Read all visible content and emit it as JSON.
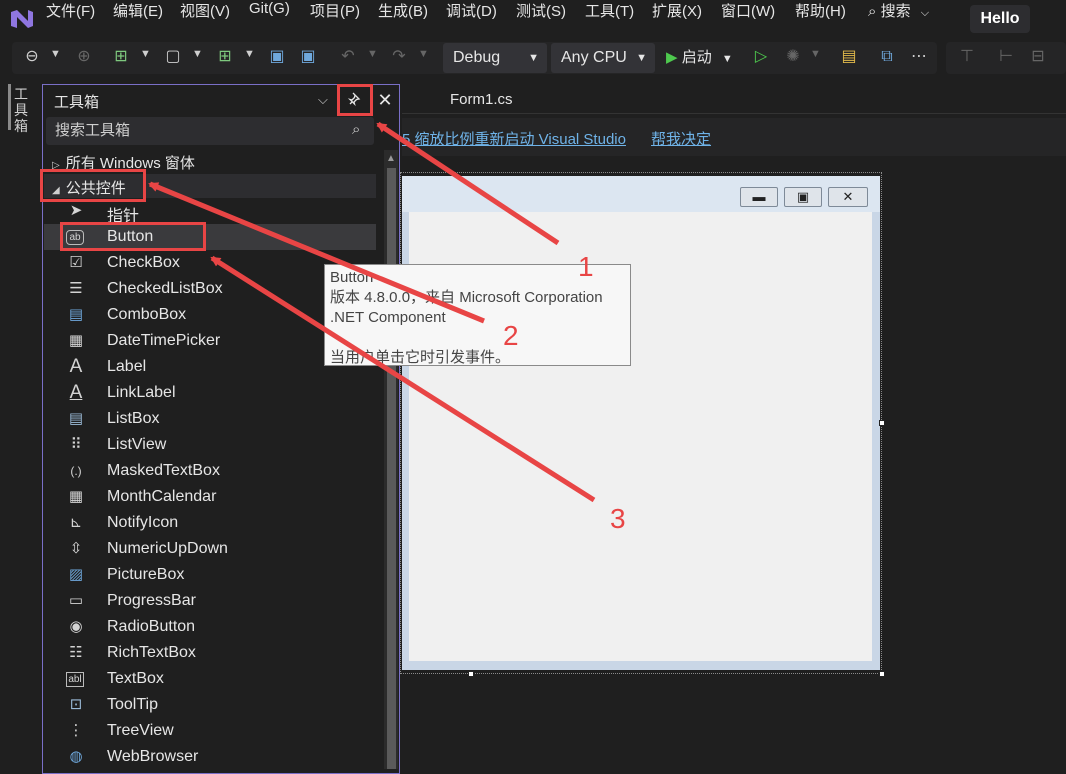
{
  "menubar": {
    "items": [
      "文件(F)",
      "编辑(E)",
      "视图(V)",
      "Git(G)",
      "项目(P)",
      "生成(B)",
      "调试(D)",
      "测试(S)",
      "工具(T)",
      "扩展(X)",
      "窗口(W)",
      "帮助(H)"
    ],
    "search_label": "搜索",
    "profile_label": "Hello"
  },
  "toolbar": {
    "config": "Debug",
    "platform": "Any CPU",
    "start_label": "启动"
  },
  "left_strip": {
    "label": "工具箱"
  },
  "toolbox": {
    "title": "工具箱",
    "search_placeholder": "搜索工具箱",
    "groups": [
      {
        "label": "所有 Windows 窗体",
        "expanded": false
      },
      {
        "label": "公共控件",
        "expanded": true
      }
    ],
    "items": [
      {
        "label": "指针",
        "icon": "pointer-icon"
      },
      {
        "label": "Button",
        "icon": "button-icon"
      },
      {
        "label": "CheckBox",
        "icon": "checkbox-icon"
      },
      {
        "label": "CheckedListBox",
        "icon": "checkedlistbox-icon"
      },
      {
        "label": "ComboBox",
        "icon": "combobox-icon"
      },
      {
        "label": "DateTimePicker",
        "icon": "datetimepicker-icon"
      },
      {
        "label": "Label",
        "icon": "label-icon"
      },
      {
        "label": "LinkLabel",
        "icon": "linklabel-icon"
      },
      {
        "label": "ListBox",
        "icon": "listbox-icon"
      },
      {
        "label": "ListView",
        "icon": "listview-icon"
      },
      {
        "label": "MaskedTextBox",
        "icon": "maskedtextbox-icon"
      },
      {
        "label": "MonthCalendar",
        "icon": "monthcalendar-icon"
      },
      {
        "label": "NotifyIcon",
        "icon": "notifyicon-icon"
      },
      {
        "label": "NumericUpDown",
        "icon": "numericupdown-icon"
      },
      {
        "label": "PictureBox",
        "icon": "picturebox-icon"
      },
      {
        "label": "ProgressBar",
        "icon": "progressbar-icon"
      },
      {
        "label": "RadioButton",
        "icon": "radiobutton-icon"
      },
      {
        "label": "RichTextBox",
        "icon": "richtextbox-icon"
      },
      {
        "label": "TextBox",
        "icon": "textbox-icon"
      },
      {
        "label": "ToolTip",
        "icon": "tooltip-icon"
      },
      {
        "label": "TreeView",
        "icon": "treeview-icon"
      },
      {
        "label": "WebBrowser",
        "icon": "webbrowser-icon"
      }
    ]
  },
  "editor": {
    "tab_label": "Form1.cs",
    "info_text": "5 缩放比例重新启动 Visual Studio",
    "info_link": "帮我决定"
  },
  "tooltip": {
    "lines": [
      "Button",
      "版本 4.8.0.0，来自 Microsoft Corporation",
      ".NET Component",
      "",
      "当用户单击它时引发事件。"
    ]
  },
  "annotations": {
    "num1": "1",
    "num2": "2",
    "num3": "3",
    "color": "#e84545"
  }
}
